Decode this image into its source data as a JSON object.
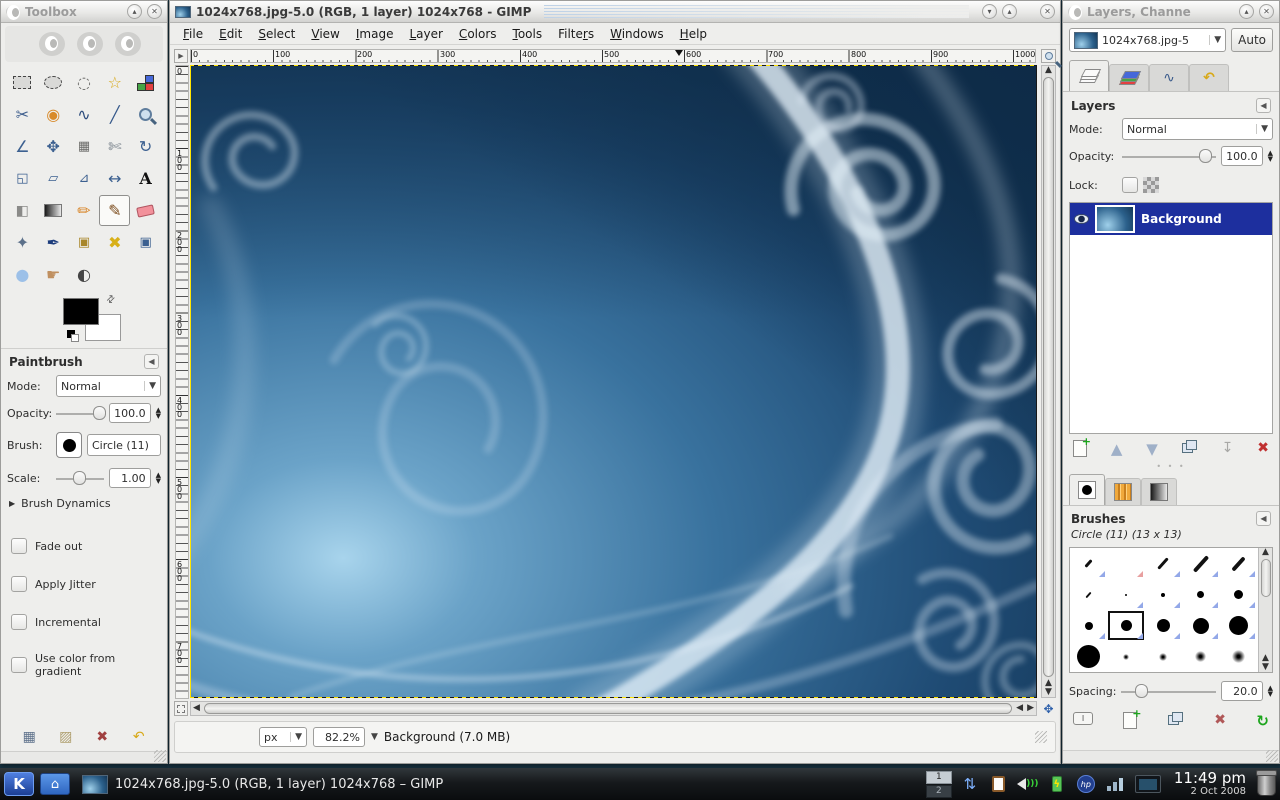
{
  "toolbox": {
    "title": "Toolbox",
    "tools": [
      "rect-select",
      "ellipse-select",
      "free-select",
      "fuzzy-select",
      "select-by-color",
      "scissors-select",
      "foreground-select",
      "paths",
      "color-picker",
      "zoom",
      "measure",
      "move",
      "align",
      "crop",
      "rotate",
      "scale",
      "shear",
      "perspective",
      "flip",
      "text",
      "bucket-fill",
      "gradient",
      "pencil",
      "paintbrush",
      "eraser",
      "airbrush",
      "ink",
      "clone",
      "heal",
      "perspective-clone",
      "blur-sharpen",
      "smudge",
      "dodge-burn"
    ],
    "selected_tool": "paintbrush",
    "fg_color": "#000000",
    "bg_color": "#ffffff"
  },
  "tool_options": {
    "title": "Paintbrush",
    "mode_label": "Mode:",
    "mode_value": "Normal",
    "opacity_label": "Opacity:",
    "opacity_value": "100.0",
    "brush_label": "Brush:",
    "brush_value": "Circle (11)",
    "scale_label": "Scale:",
    "scale_value": "1.00",
    "expander": "Brush Dynamics",
    "checkboxes": [
      "Fade out",
      "Apply Jitter",
      "Incremental",
      "Use color from gradient"
    ]
  },
  "image_window": {
    "title": "1024x768.jpg-5.0 (RGB, 1 layer) 1024x768 - GIMP",
    "menus": [
      {
        "label": "File",
        "u": 0
      },
      {
        "label": "Edit",
        "u": 0
      },
      {
        "label": "Select",
        "u": 0
      },
      {
        "label": "View",
        "u": 0
      },
      {
        "label": "Image",
        "u": 0
      },
      {
        "label": "Layer",
        "u": 0
      },
      {
        "label": "Colors",
        "u": 0
      },
      {
        "label": "Tools",
        "u": 0
      },
      {
        "label": "Filters",
        "u": 5
      },
      {
        "label": "Windows",
        "u": 0
      },
      {
        "label": "Help",
        "u": 0
      }
    ],
    "hruler": [
      "0",
      "100",
      "200",
      "300",
      "400",
      "500",
      "600",
      "700",
      "800",
      "900",
      "1000"
    ],
    "vruler": [
      "0",
      "100",
      "200",
      "300",
      "400",
      "500",
      "600",
      "700"
    ],
    "statusbar": {
      "unit": "px",
      "zoom": "82.2%",
      "status": "Background (7.0 MB)"
    }
  },
  "layers_dialog": {
    "title": "Layers, Channe",
    "image_selector": "1024x768.jpg-5",
    "auto_button": "Auto",
    "tabs": [
      "layers",
      "channels",
      "paths",
      "undo-history"
    ],
    "section_title": "Layers",
    "mode_label": "Mode:",
    "mode_value": "Normal",
    "opacity_label": "Opacity:",
    "opacity_value": "100.0",
    "lock_label": "Lock:",
    "layers": [
      {
        "name": "Background",
        "visible": true,
        "selected": true
      }
    ]
  },
  "brushes_dialog": {
    "section_title": "Brushes",
    "current_brush": "Circle (11) (13 x 13)",
    "spacing_label": "Spacing:",
    "spacing_value": "20.0",
    "tabs": [
      "brushes",
      "patterns",
      "gradients"
    ]
  },
  "taskbar": {
    "task_title": "1024x768.jpg-5.0 (RGB, 1 layer) 1024x768 – GIMP",
    "pager": [
      "1",
      "2"
    ],
    "tray_icons": [
      "file-transfer",
      "clipboard",
      "volume",
      "battery",
      "hp-monitor",
      "signal-strength",
      "display-settings"
    ],
    "clock": {
      "time": "11:49 pm",
      "date": "2 Oct 2008"
    }
  },
  "colors": {
    "selection_blue": "#1d2f9e",
    "canvas_dark": "#143757",
    "canvas_bright": "#a8d4ec",
    "layer_boundary_yellow": "#ffe400"
  }
}
